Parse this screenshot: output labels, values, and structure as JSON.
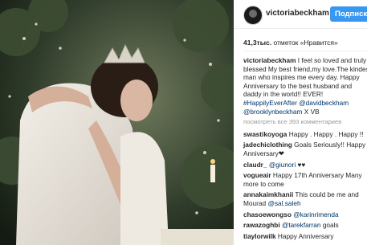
{
  "post": {
    "username": "victoriabeckham",
    "follow_label": "Подписка",
    "likes_count": "41,3тыс.",
    "likes_label": "отметок «Нравится»",
    "view_more": "посмотреть все 393 комментариев"
  },
  "caption": {
    "user": "victoriabeckham",
    "text": "I feel so loved and truly blessed My best friend,my love.The kindest man who inspires me every day. Happy Anniversary to the best husband and daddy in the world!! EVER!",
    "tags": [
      "#HappilyEverAfter",
      "@davidbeckham",
      "@brooklynbeckham"
    ],
    "tail": "X VB"
  },
  "comments": [
    {
      "user": "swastikoyoga",
      "text": "Happy . Happy . Happy !!"
    },
    {
      "user": "jadechiclothing",
      "text": "Goals Seriously!! Happy Anniversary❤"
    },
    {
      "user": "claudr_",
      "mention": "@giunori",
      "text": "♥♥"
    },
    {
      "user": "vogueair",
      "text": "Happy 17th Anniversary Many more to come"
    },
    {
      "user": "annakaimkhanii",
      "text": "This could be me and Mourad",
      "mention": "@sal.saleh"
    },
    {
      "user": "chasoewongso",
      "mention": "@karinrimenda"
    },
    {
      "user": "rawazoghbi",
      "mention": "@tarekfarran",
      "text": "goals"
    },
    {
      "user": "tiaylorwilk",
      "text": "Happy Anniversary"
    }
  ],
  "colors": {
    "follow": "#3897f0",
    "link": "#003569",
    "muted": "#999999"
  }
}
